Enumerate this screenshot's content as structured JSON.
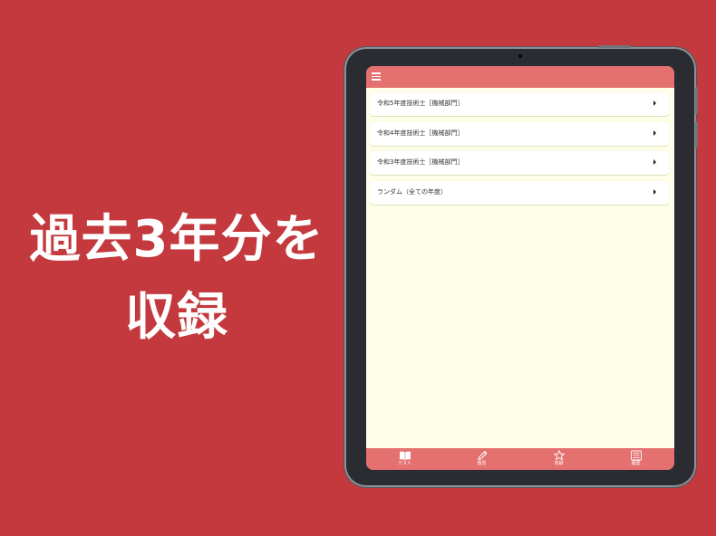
{
  "headline": {
    "line1": "過去3年分を",
    "line2": "収録"
  },
  "app": {
    "list_items": [
      {
        "label": "令和5年度技術士［機械部門］"
      },
      {
        "label": "令和4年度技術士［機械部門］"
      },
      {
        "label": "令和3年度技術士［機械部門］"
      },
      {
        "label": "ランダム（全ての年度）"
      }
    ],
    "tabs": [
      {
        "label": "テスト",
        "icon": "book-icon"
      },
      {
        "label": "復習",
        "icon": "pencil-icon"
      },
      {
        "label": "収録",
        "icon": "star-icon"
      },
      {
        "label": "履歴",
        "icon": "list-icon"
      }
    ]
  },
  "colors": {
    "background": "#c4393d",
    "app_bar": "#e57070",
    "screen_bg": "#fefee9"
  }
}
